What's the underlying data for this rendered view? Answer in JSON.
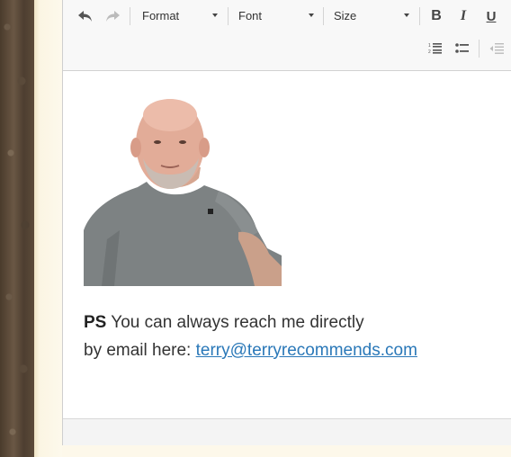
{
  "toolbar": {
    "undo_icon": "undo-icon",
    "redo_icon": "redo-icon",
    "format_label": "Format",
    "font_label": "Font",
    "size_label": "Size",
    "bold_label": "B",
    "italic_label": "I",
    "underline_label": "U",
    "numbered_list_icon": "numbered-list-icon",
    "bulleted_list_icon": "bulleted-list-icon",
    "outdent_icon": "outdent-icon"
  },
  "content": {
    "photo_alt": "portrait photo",
    "ps_bold": "PS",
    "ps_line1": " You can always reach me directly",
    "ps_line2": "by email here: ",
    "email_link": "terry@terryrecommends.com"
  },
  "colors": {
    "link": "#2a78b8",
    "toolbar_bg": "#f8f8f8",
    "text": "#333333"
  }
}
